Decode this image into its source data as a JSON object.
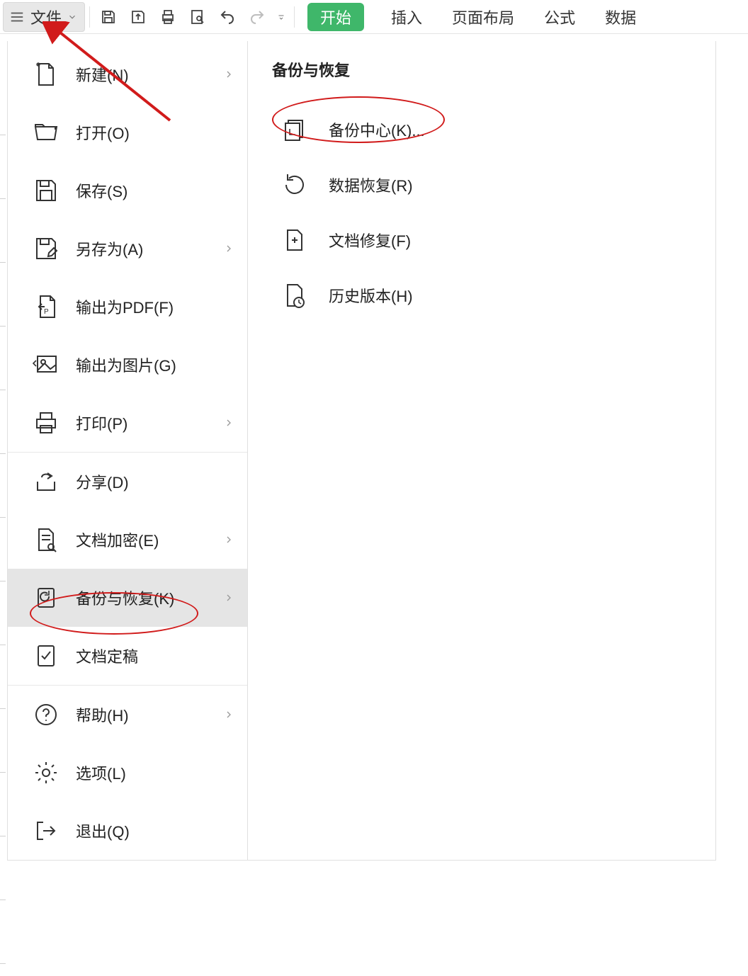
{
  "toolbar": {
    "file_button": "文件"
  },
  "ribbon": {
    "tabs": [
      "开始",
      "插入",
      "页面布局",
      "公式",
      "数据"
    ]
  },
  "file_menu": {
    "items": [
      {
        "label": "新建(N)",
        "has_sub": true
      },
      {
        "label": "打开(O)",
        "has_sub": false
      },
      {
        "label": "保存(S)",
        "has_sub": false
      },
      {
        "label": "另存为(A)",
        "has_sub": true
      },
      {
        "label": "输出为PDF(F)",
        "has_sub": false
      },
      {
        "label": "输出为图片(G)",
        "has_sub": false
      },
      {
        "label": "打印(P)",
        "has_sub": true
      },
      {
        "label": "分享(D)",
        "has_sub": false
      },
      {
        "label": "文档加密(E)",
        "has_sub": true
      },
      {
        "label": "备份与恢复(K)",
        "has_sub": true,
        "selected": true
      },
      {
        "label": "文档定稿",
        "has_sub": false
      },
      {
        "label": "帮助(H)",
        "has_sub": true
      },
      {
        "label": "选项(L)",
        "has_sub": false
      },
      {
        "label": "退出(Q)",
        "has_sub": false
      }
    ]
  },
  "submenu": {
    "title": "备份与恢复",
    "items": [
      {
        "label": "备份中心(K)...",
        "highlighted": true
      },
      {
        "label": "数据恢复(R)"
      },
      {
        "label": "文档修复(F)"
      },
      {
        "label": "历史版本(H)"
      }
    ]
  },
  "annotation_colors": {
    "red": "#d11b1b"
  }
}
